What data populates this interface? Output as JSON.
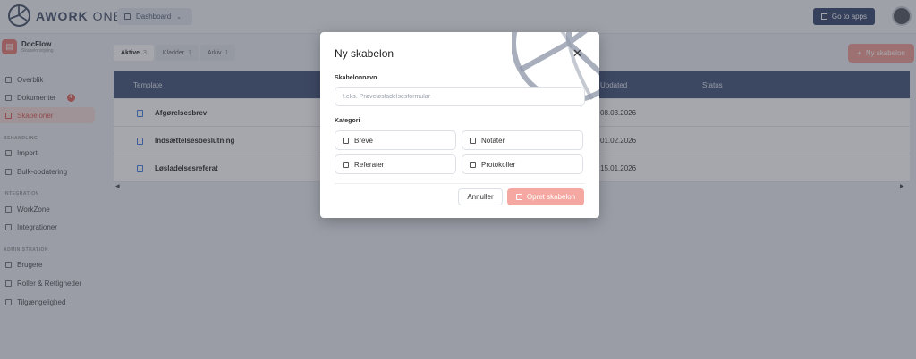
{
  "app": {
    "logo_bold": "AWORK",
    "logo_thin": "ONE"
  },
  "topbar": {
    "dashboard_label": "Dashboard",
    "apps_label": "Go to apps"
  },
  "sidebar": {
    "brand_name": "DocFlow",
    "brand_sub": "Skabelonstyring",
    "items": [
      {
        "label": "Overblik"
      },
      {
        "label": "Dokumenter",
        "badge": "4"
      },
      {
        "label": "Skabeloner"
      }
    ],
    "section_1": "BEHANDLING",
    "section_1_items": [
      {
        "label": "Import"
      },
      {
        "label": "Bulk-opdatering"
      }
    ],
    "section_2": "INTEGRATION",
    "section_2_items": [
      {
        "label": "WorkZone"
      },
      {
        "label": "Integrationer"
      }
    ],
    "section_3": "ADMINISTRATION",
    "section_3_items": [
      {
        "label": "Brugere"
      },
      {
        "label": "Roller & Rettigheder"
      },
      {
        "label": "Tilgængelighed"
      }
    ]
  },
  "main": {
    "tabs": [
      {
        "label": "Aktive",
        "count": "3"
      },
      {
        "label": "Kladder",
        "count": "1"
      },
      {
        "label": "Arkiv",
        "count": "1"
      }
    ],
    "new_button": "Ny skabelon",
    "columns": {
      "template": "Template",
      "updated": "Updated",
      "status": "Status"
    },
    "rows": [
      {
        "name": "Afgørelsesbrev",
        "date": "08.03.2026"
      },
      {
        "name": "Indsættelsesbeslutning",
        "date": "01.02.2026"
      },
      {
        "name": "Løsladelsesreferat",
        "date": "15.01.2026"
      }
    ]
  },
  "modal": {
    "title": "Ny skabelon",
    "name_label": "Skabelonnavn",
    "name_placeholder": "f.eks. Prøveløsladelsesformular",
    "category_label": "Kategori",
    "categories": [
      "Breve",
      "Notater",
      "Referater",
      "Protokoller"
    ],
    "cancel": "Annuller",
    "create": "Opret skabelon"
  }
}
